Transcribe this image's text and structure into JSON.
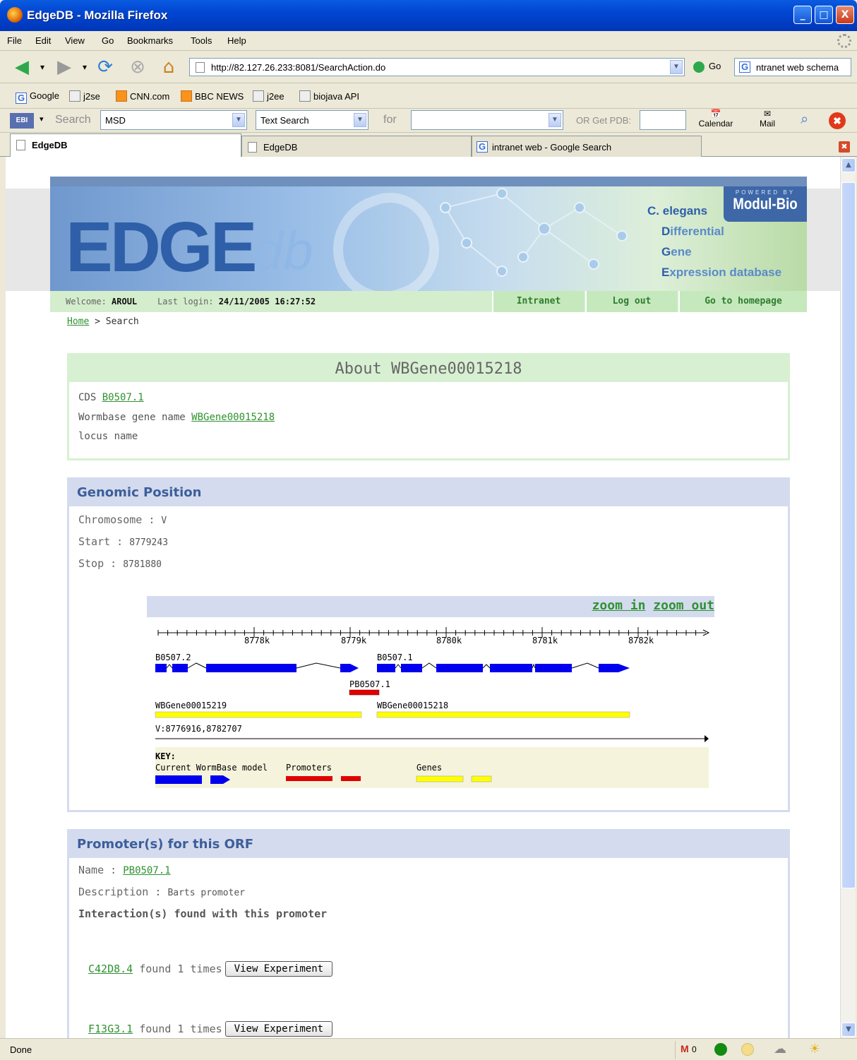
{
  "window": {
    "title": "EdgeDB - Mozilla Firefox",
    "min": "_",
    "max": "□",
    "close": "X"
  },
  "menu": [
    "File",
    "Edit",
    "View",
    "Go",
    "Bookmarks",
    "Tools",
    "Help"
  ],
  "nav": {
    "url": "http://82.127.26.233:8081/SearchAction.do",
    "go_label": "Go",
    "google_value": "ntranet web schema"
  },
  "bookmarks": [
    "Google",
    "j2se",
    "CNN.com",
    "BBC NEWS",
    "j2ee",
    "biojava API"
  ],
  "ebi": {
    "search_label": "Search",
    "db_value": "MSD",
    "type_value": "Text Search",
    "for_label": "for",
    "pdb_label": "OR Get PDB:",
    "calendar_label": "Calendar",
    "mail_label": "Mail"
  },
  "tabs": [
    "EdgeDB",
    "EdgeDB",
    "intranet web - Google Search"
  ],
  "status": {
    "text": "Done",
    "mail_count": "0"
  },
  "site": {
    "brand_main": "EDGE",
    "brand_sub": "db",
    "tagline": [
      [
        "C.",
        "elegans"
      ],
      [
        "D",
        "ifferential"
      ],
      [
        "G",
        "ene"
      ],
      [
        "E",
        "xpression database"
      ]
    ],
    "powered_by": "POWERED BY",
    "modul": "Modul-Bio",
    "welcome_label": "Welcome:",
    "user": "AROUL",
    "last_login_label": "Last login:",
    "last_login": "24/11/2005 16:27:52",
    "links": [
      "Intranet",
      "Log out",
      "Go to homepage"
    ],
    "crumb_home": "Home",
    "crumb_rest": " > Search"
  },
  "about": {
    "title": "About WBGene00015218",
    "cds_label": "CDS",
    "cds": "B0507.1",
    "wb_label": "Wormbase gene name",
    "wb": "WBGene00015218",
    "locus_label": "locus name"
  },
  "genomic": {
    "title": "Genomic Position",
    "chrom_label": "Chromosome :",
    "chrom": "V",
    "start_label": "Start :",
    "start": "8779243",
    "stop_label": "Stop :",
    "stop": "8781880",
    "zoom_in": "zoom in",
    "zoom_out": "zoom out"
  },
  "track": {
    "ticks": [
      "8778k",
      "8779k",
      "8780k",
      "8781k",
      "8782k"
    ],
    "gene1": "B0507.2",
    "gene2": "B0507.1",
    "promoter": "PB0507.1",
    "wb1": "WBGene00015219",
    "wb2": "WBGene00015218",
    "range": "V:8776916,8782707",
    "key_title": "KEY:",
    "key_model": "Current WormBase model",
    "key_prom": "Promoters",
    "key_genes": "Genes",
    "colors": {
      "model": "#0000EE",
      "promoter": "#E00000",
      "gene": "#FFFF00"
    }
  },
  "promoter": {
    "title": "Promoter(s) for this ORF",
    "name_label": "Name :",
    "name": "PB0507.1",
    "desc_label": "Description :",
    "desc": "Barts promoter",
    "interactions_title": "Interaction(s) found with this promoter",
    "items": [
      {
        "gene": "C42D8.4",
        "text": "found 1 times",
        "button": "View Experiment"
      },
      {
        "gene": "F13G3.1",
        "text": "found 1 times",
        "button": "View Experiment"
      }
    ]
  }
}
